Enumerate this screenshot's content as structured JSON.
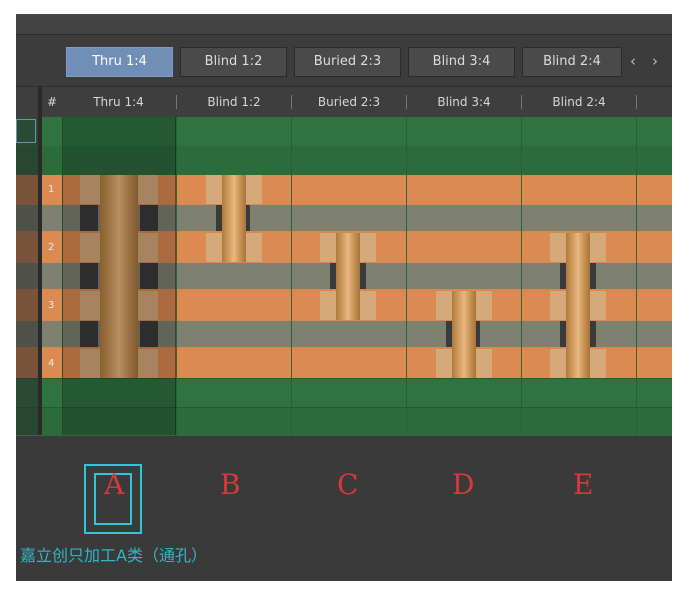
{
  "tabs": [
    {
      "label": "Thru 1:4",
      "active": true
    },
    {
      "label": "Blind 1:2",
      "active": false
    },
    {
      "label": "Buried 2:3",
      "active": false
    },
    {
      "label": "Blind 3:4",
      "active": false
    },
    {
      "label": "Blind 2:4",
      "active": false
    }
  ],
  "nav": {
    "prev": "‹",
    "next": "›"
  },
  "header": {
    "hash": "#",
    "columns": [
      "Thru 1:4",
      "Blind 1:2",
      "Buried 2:3",
      "Blind 3:4",
      "Blind 2:4"
    ]
  },
  "row_numbers": [
    "1",
    "2",
    "3",
    "4"
  ],
  "colors": {
    "soldermask": "#2e6e3c",
    "copper": "#d9894f",
    "dielectric": "#7d7f6e",
    "barrel": "#c9904f",
    "pad": "#d6a97b",
    "annotation_red": "#d8383c",
    "annotation_cyan": "#2fc6d6"
  },
  "annotations": {
    "letters": [
      "A",
      "B",
      "C",
      "D",
      "E"
    ],
    "caption": "嘉立创只加工A类（通孔）"
  }
}
